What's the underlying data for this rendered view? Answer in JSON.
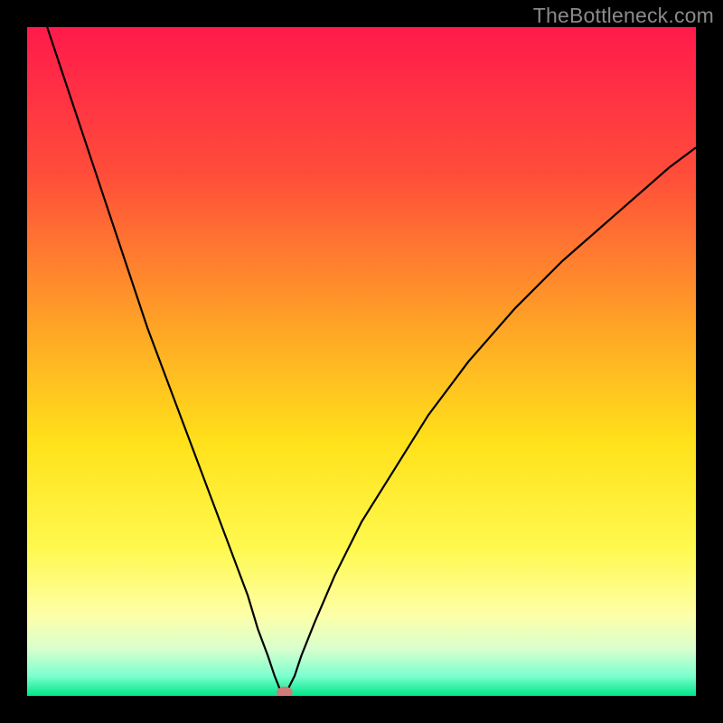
{
  "watermark": "TheBottleneck.com",
  "chart_data": {
    "type": "line",
    "title": "",
    "xlabel": "",
    "ylabel": "",
    "xlim": [
      0,
      100
    ],
    "ylim": [
      0,
      100
    ],
    "grid": false,
    "legend": false,
    "background_gradient": [
      {
        "offset": 0.0,
        "color": "#ff1a4b"
      },
      {
        "offset": 0.22,
        "color": "#ff4d3a"
      },
      {
        "offset": 0.45,
        "color": "#ffa526"
      },
      {
        "offset": 0.62,
        "color": "#ffe11a"
      },
      {
        "offset": 0.78,
        "color": "#fff94f"
      },
      {
        "offset": 0.88,
        "color": "#fdffa8"
      },
      {
        "offset": 0.93,
        "color": "#d8ffce"
      },
      {
        "offset": 0.97,
        "color": "#7dffcf"
      },
      {
        "offset": 1.0,
        "color": "#00e689"
      }
    ],
    "series": [
      {
        "name": "bottleneck-curve",
        "color": "#000000",
        "x": [
          3,
          6,
          9,
          12,
          15,
          18,
          21,
          24,
          27,
          30,
          33,
          34.5,
          36,
          37,
          37.8,
          38.5,
          39,
          40,
          41,
          43,
          46,
          50,
          55,
          60,
          66,
          73,
          80,
          88,
          96,
          100
        ],
        "y": [
          100,
          91,
          82,
          73,
          64,
          55,
          47,
          39,
          31,
          23,
          15,
          10,
          6,
          3,
          1,
          0.5,
          1,
          3,
          6,
          11,
          18,
          26,
          34,
          42,
          50,
          58,
          65,
          72,
          79,
          82
        ]
      }
    ],
    "marker": {
      "name": "optimal-point",
      "x": 38.5,
      "y": 0.5,
      "color": "#d07b78",
      "rx": 1.2,
      "ry": 0.9
    }
  }
}
